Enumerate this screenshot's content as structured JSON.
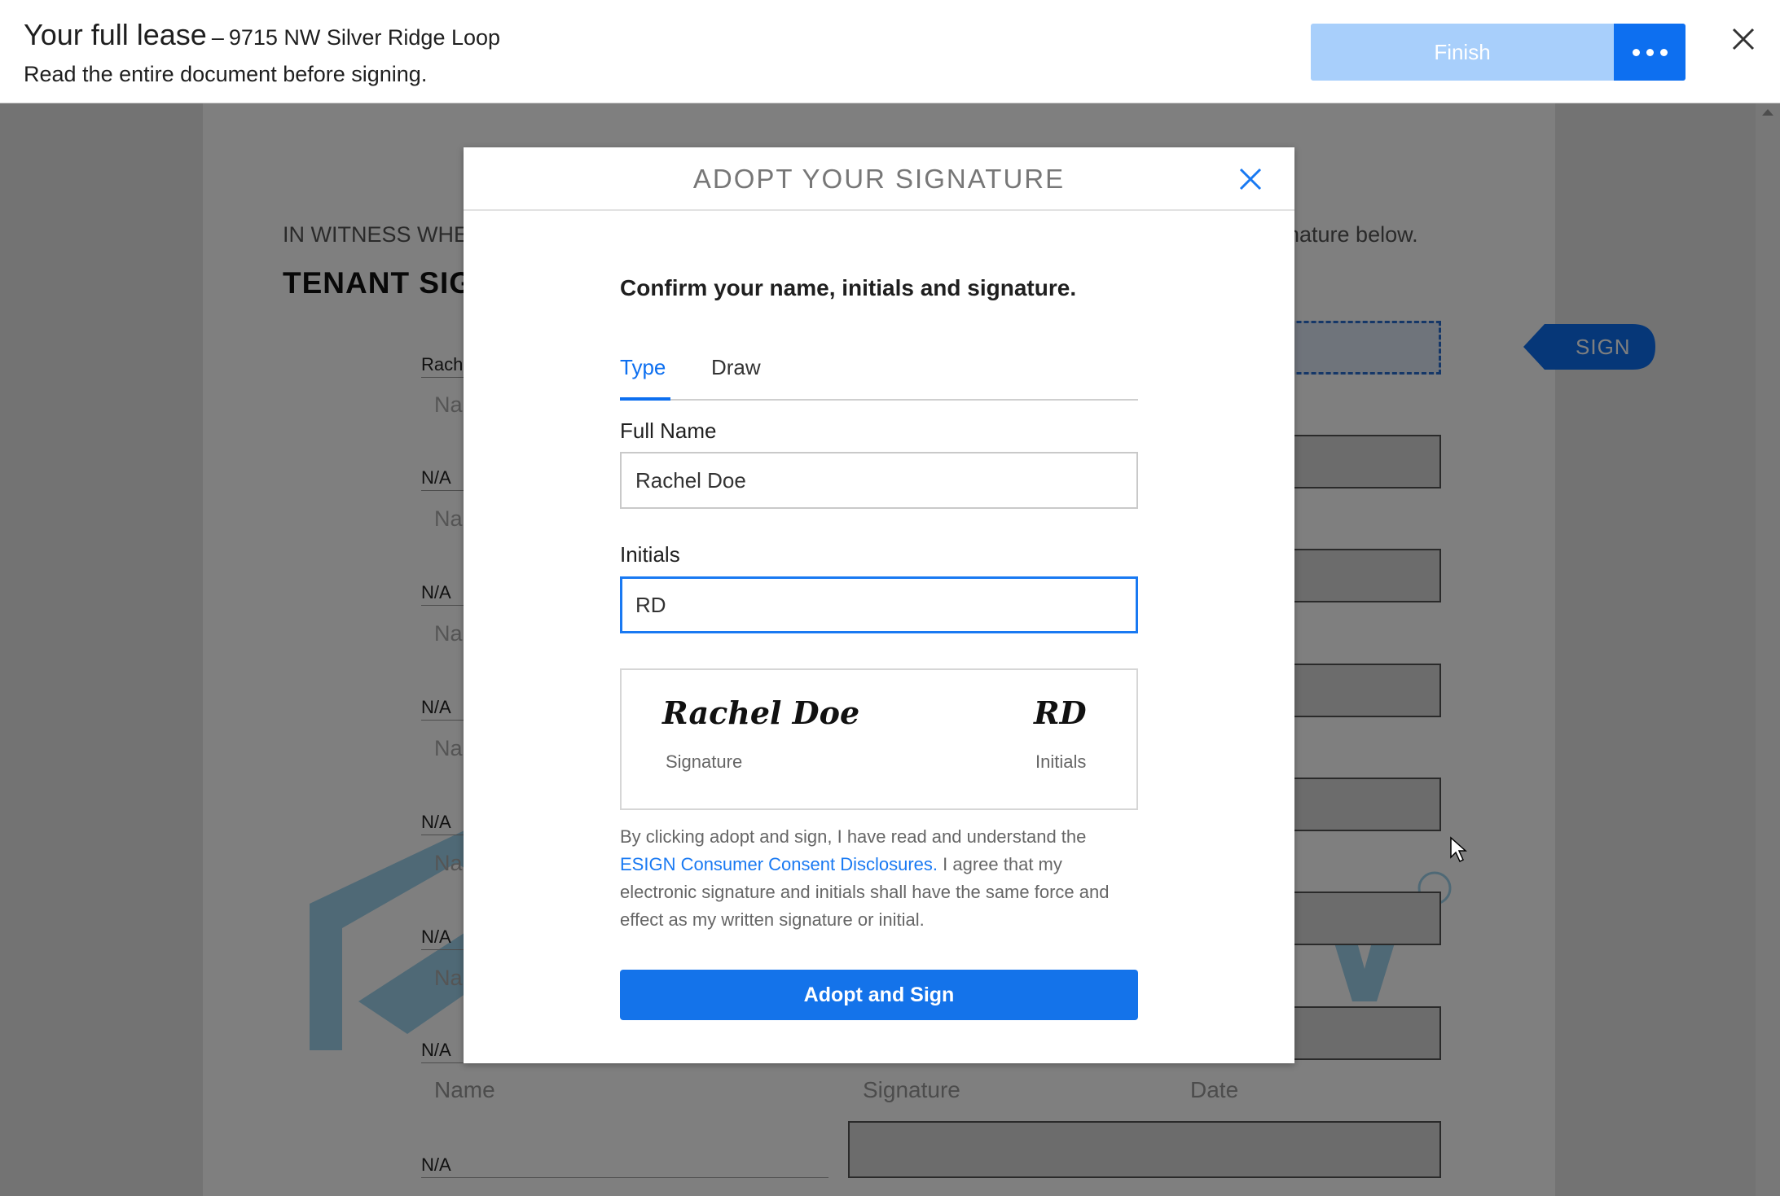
{
  "topbar": {
    "title": "Your full lease",
    "separator": "–",
    "address": "9715 NW Silver Ridge Loop",
    "subtitle": "Read the entire document before signing.",
    "finish_label": "Finish",
    "more_icon": "more-dots-icon",
    "close_icon": "close-icon"
  },
  "document": {
    "witness_text_start": "IN WITNESS WHE",
    "witness_text_end": "nature below.",
    "tenant_heading": "TENANT SIG",
    "first_row_label": "Rach",
    "rows": [
      {
        "label": "N/A",
        "placeholder": "Na"
      },
      {
        "label": "N/A",
        "placeholder": "Na"
      },
      {
        "label": "N/A",
        "placeholder": "Na"
      },
      {
        "label": "N/A",
        "placeholder": "Na"
      },
      {
        "label": "N/A",
        "placeholder": "Na"
      },
      {
        "label": "N/A",
        "placeholder": "Na"
      }
    ],
    "name_placeholder": "Na",
    "footer_name": "Name",
    "footer_signature": "Signature",
    "footer_date": "Date",
    "last_row_label": "N/A",
    "sign_tag_label": "SIGN"
  },
  "modal": {
    "title": "ADOPT YOUR SIGNATURE",
    "heading": "Confirm your name, initials and signature.",
    "tabs": [
      {
        "label": "Type",
        "active": true
      },
      {
        "label": "Draw",
        "active": false
      }
    ],
    "full_name_label": "Full Name",
    "full_name_value": "Rachel Doe",
    "initials_label": "Initials",
    "initials_value": "RD",
    "preview": {
      "signature_text": "Rachel Doe",
      "signature_caption": "Signature",
      "initials_text": "RD",
      "initials_caption": "Initials"
    },
    "legal_before": "By clicking adopt and sign, I have read and understand the ",
    "legal_link": "ESIGN Consumer Consent Disclosures.",
    "legal_after": " I agree that my electronic signature and initials shall have the same force and effect as my written signature or initial.",
    "adopt_label": "Adopt and Sign"
  },
  "colors": {
    "accent": "#0d6ff0",
    "finish_disabled": "#a8cffb",
    "overlay": "rgba(0,0,0,0.5)"
  }
}
